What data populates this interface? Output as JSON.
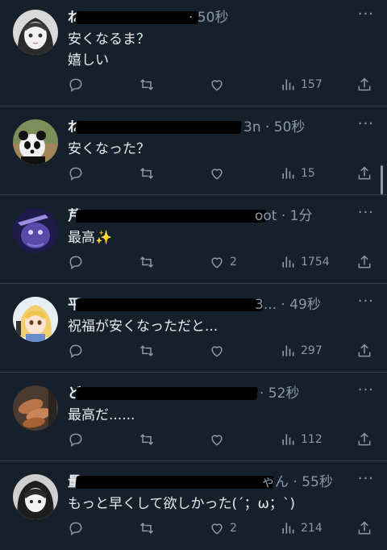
{
  "tweets": [
    {
      "name_start": "ね",
      "time": "· 50秒",
      "text_line1": "安くなるま？",
      "text_line2": "嬉しい",
      "reply_count": "",
      "like_count": "",
      "view_count": "157",
      "avatar": "anime-girl-avatar",
      "more_label": "···"
    },
    {
      "name_start": "ね",
      "time": "3n · 50秒",
      "text_line1": "安くなった？",
      "text_line2": "",
      "like_count": "",
      "view_count": "15",
      "avatar": "panda-avatar",
      "more_label": "···"
    },
    {
      "name_start": "芹",
      "time": "oot · 1分",
      "text_line1": "最高✨",
      "text_line2": "",
      "like_count": "2",
      "view_count": "1754",
      "avatar": "purple-creature-avatar",
      "more_label": "···"
    },
    {
      "name_start": "平",
      "time": "3... · 49秒",
      "text_line1": "祝福が安くなっただと...",
      "text_line2": "",
      "like_count": "",
      "view_count": "297",
      "avatar": "blonde-anime-girl-avatar",
      "more_label": "···"
    },
    {
      "name_start": "ど",
      "time": "· 52秒",
      "text_line1": "最高だ......",
      "text_line2": "",
      "like_count": "",
      "view_count": "112",
      "avatar": "food-photo-avatar",
      "more_label": "···"
    },
    {
      "name_start": "量",
      "time": "ゃん · 55秒",
      "text_line1": "もっと早くして欲しかった(´；ω；`)",
      "text_line2": "",
      "like_count": "2",
      "view_count": "214",
      "avatar": "dark-hair-anime-avatar",
      "more_label": "···"
    }
  ],
  "colors": {
    "background": "#15202b",
    "text": "#e7e9ea",
    "muted": "#8b98a5",
    "divider": "#38444d"
  }
}
